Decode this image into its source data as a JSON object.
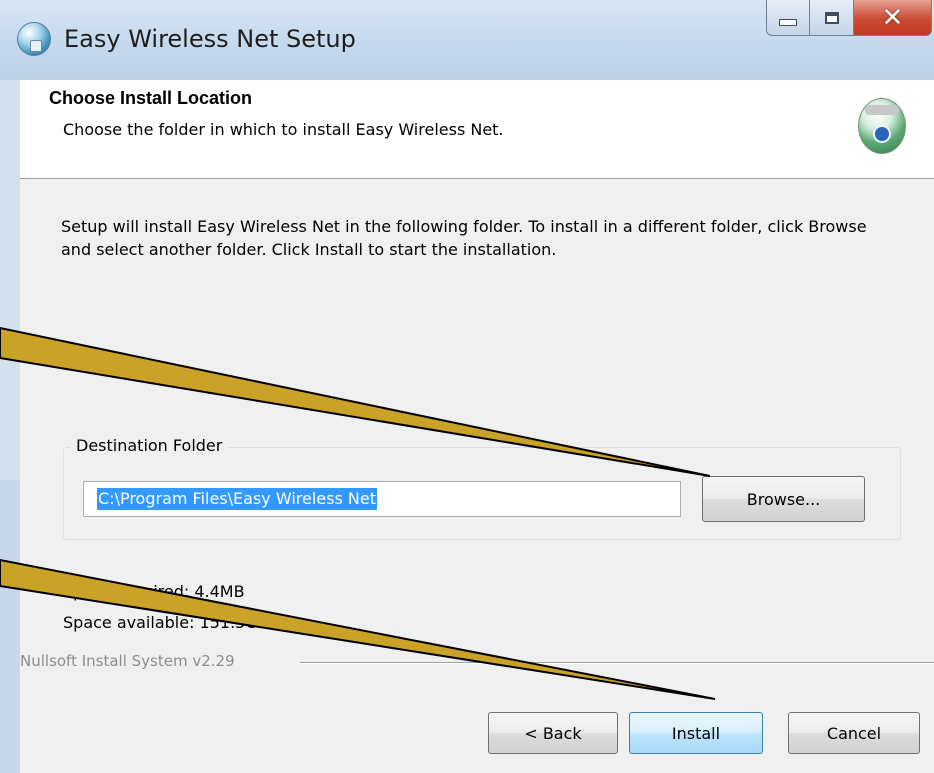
{
  "window": {
    "title": "Easy Wireless Net Setup"
  },
  "header": {
    "title": "Choose Install Location",
    "subtitle": "Choose the folder in which to install Easy Wireless Net."
  },
  "body": {
    "description": "Setup will install Easy Wireless Net in the following folder. To install in a different folder, click Browse and select another folder. Click Install to start the installation.",
    "destination": {
      "label": "Destination Folder",
      "path_value": "C:\\Program Files\\Easy Wireless Net",
      "browse_label": "Browse..."
    },
    "space_required": "Space required: 4.4MB",
    "space_available": "Space available: 151.5GB"
  },
  "footer": {
    "branding": "Nullsoft Install System v2.29",
    "back_label": "< Back",
    "install_label": "Install",
    "cancel_label": "Cancel"
  },
  "annotations": {
    "arrow_color": "#c9a227"
  }
}
